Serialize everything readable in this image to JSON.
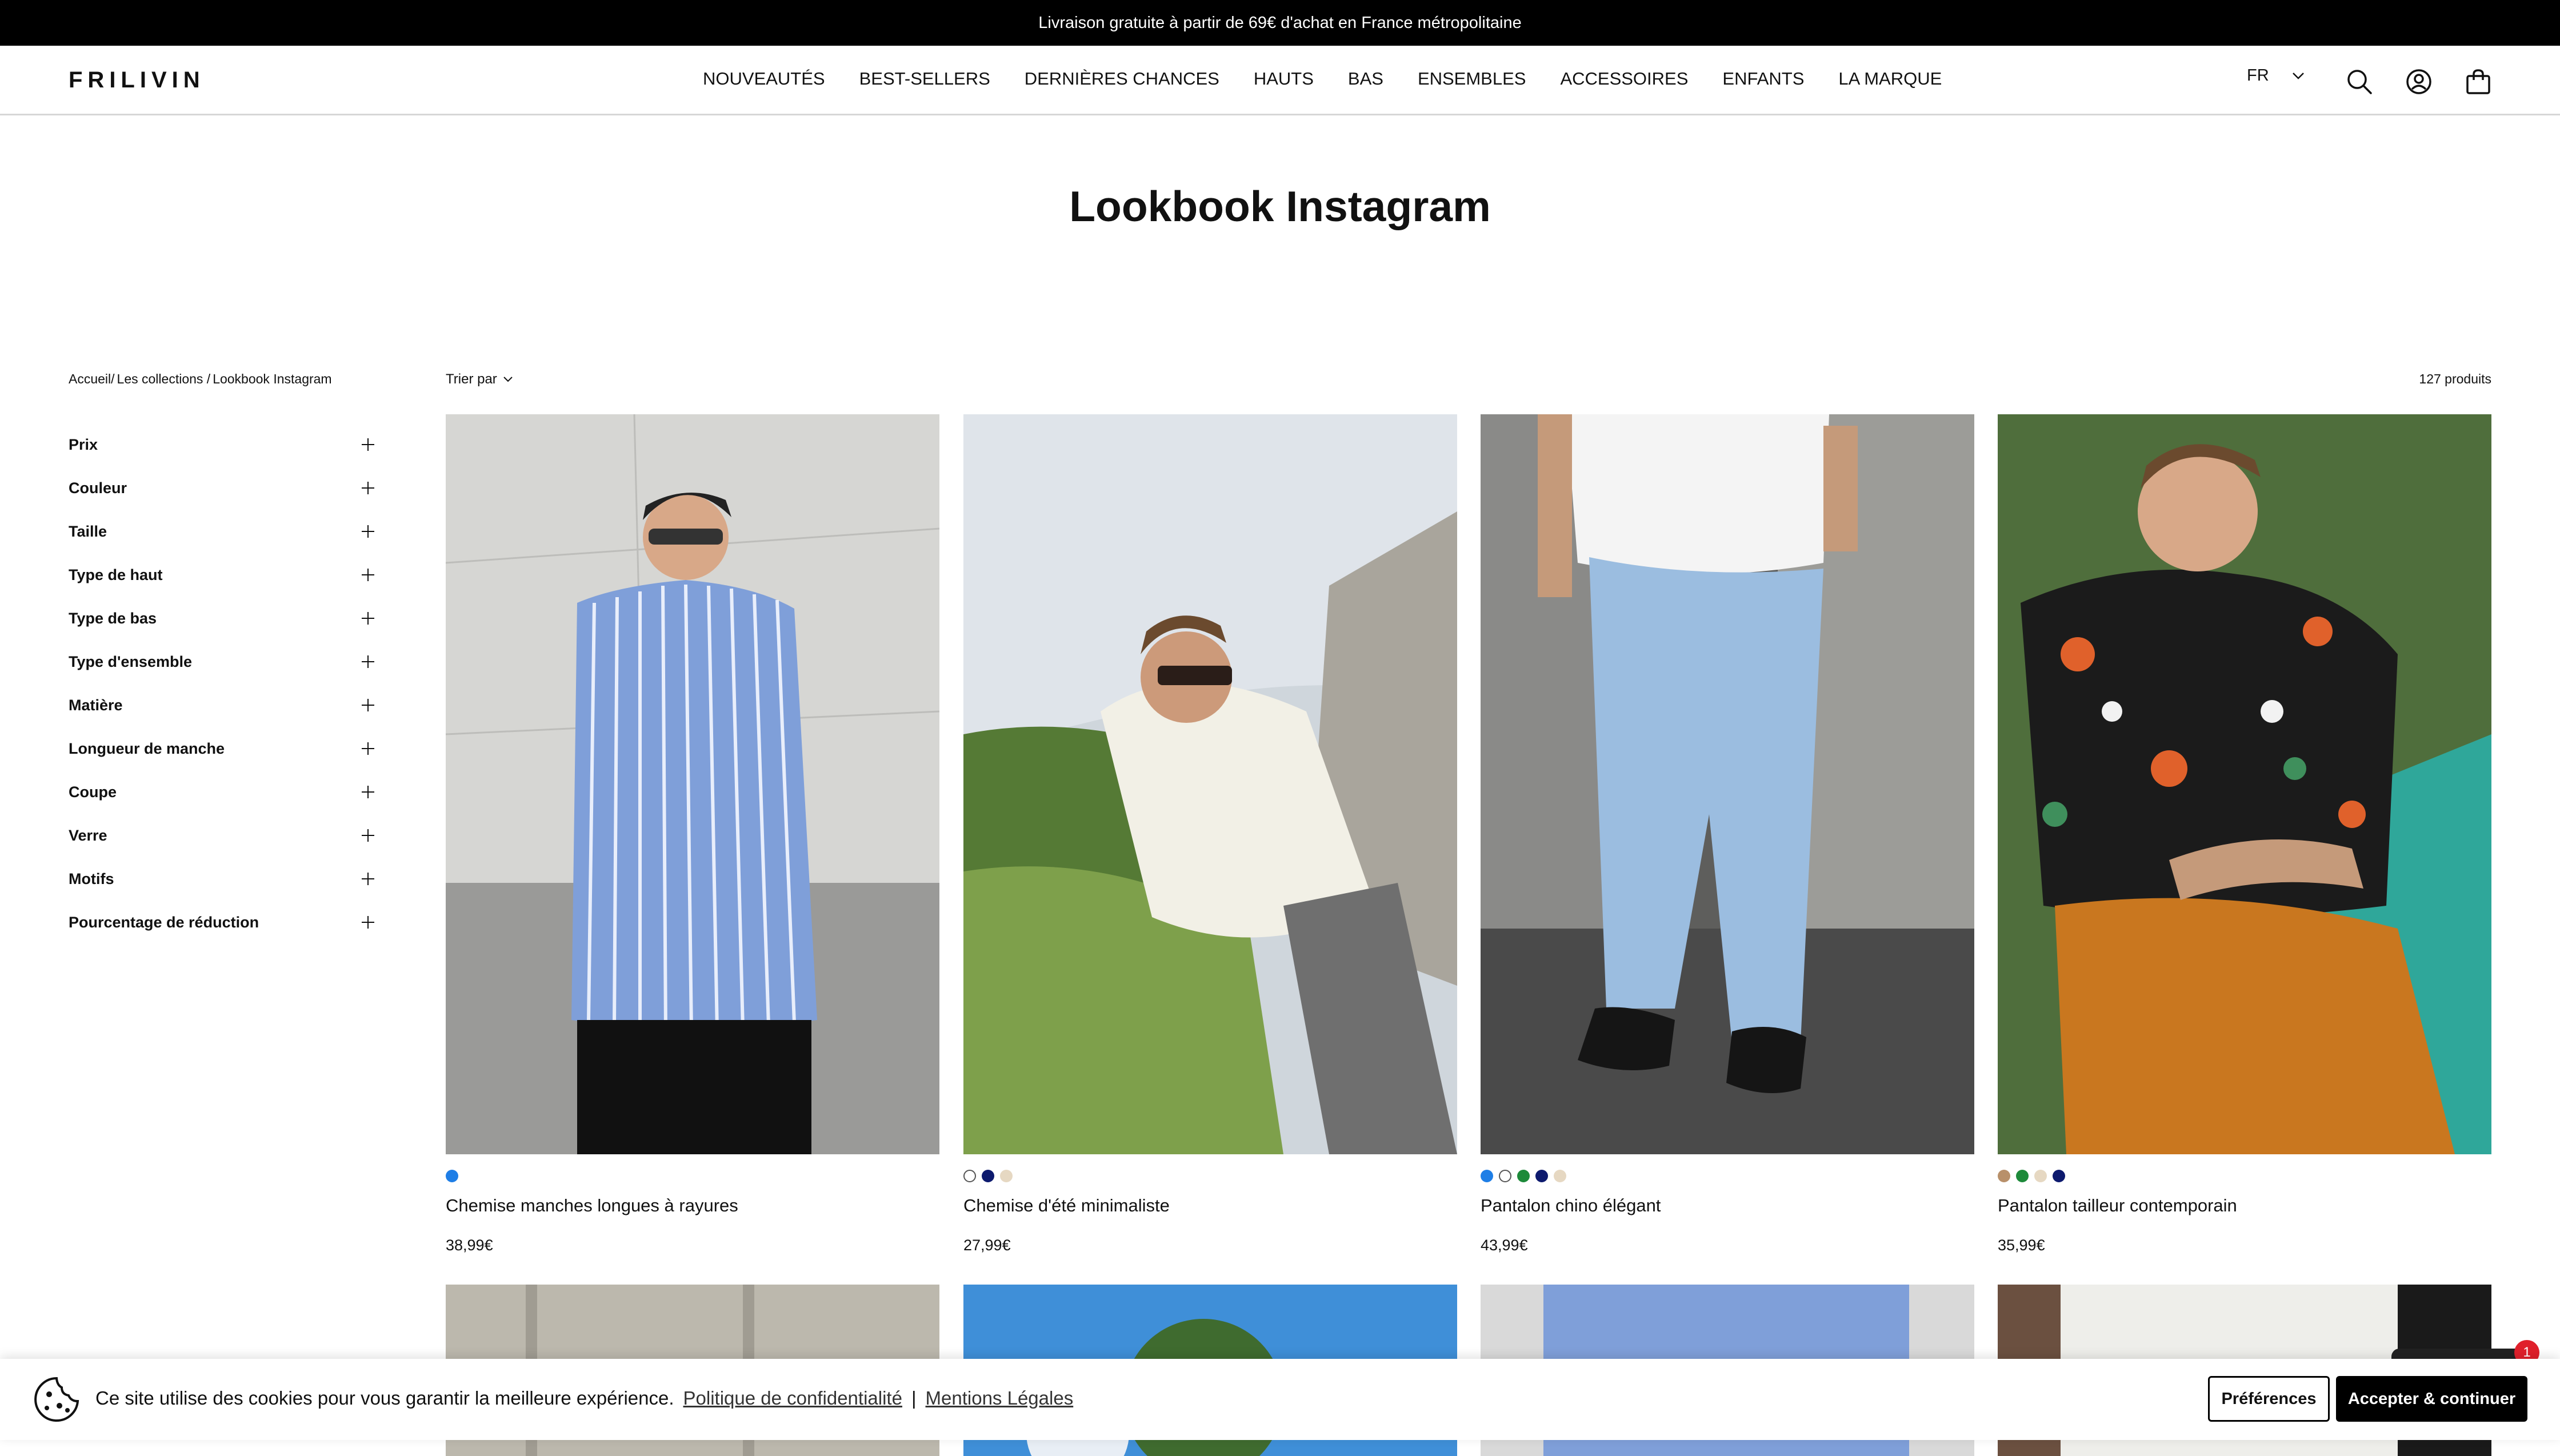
{
  "announcement": "Livraison gratuite à partir de 69€ d'achat en France métropolitaine",
  "header": {
    "logo": "FRILIVIN",
    "nav": [
      "NOUVEAUTÉS",
      "BEST-SELLERS",
      "DERNIÈRES CHANCES",
      "HAUTS",
      "BAS",
      "ENSEMBLES",
      "ACCESSOIRES",
      "ENFANTS",
      "LA MARQUE"
    ],
    "language": "FR",
    "icons": [
      "search-icon",
      "account-icon",
      "cart-icon"
    ]
  },
  "page": {
    "title": "Lookbook Instagram",
    "breadcrumb": [
      "Accueil/",
      "Les collections /",
      "Lookbook Instagram"
    ],
    "sort_label": "Trier par",
    "count": "127 produits"
  },
  "filters": [
    "Prix",
    "Couleur",
    "Taille",
    "Type de haut",
    "Type de bas",
    "Type d'ensemble",
    "Matière",
    "Longueur de manche",
    "Coupe",
    "Verre",
    "Motifs",
    "Pourcentage de réduction"
  ],
  "products": [
    {
      "name": "Chemise manches longues à rayures",
      "price": "38,99€",
      "swatches": [
        "#1e7ee6"
      ]
    },
    {
      "name": "Chemise d'été minimaliste",
      "price": "27,99€",
      "swatches": [
        "#ffffff",
        "#0d1a6e",
        "#e6d8c2"
      ]
    },
    {
      "name": "Pantalon chino élégant",
      "price": "43,99€",
      "swatches": [
        "#1e7ee6",
        "#ffffff",
        "#1d8a3a",
        "#0d1a6e",
        "#e6d8c2"
      ]
    },
    {
      "name": "Pantalon tailleur contemporain",
      "price": "35,99€",
      "swatches": [
        "#b8906a",
        "#1d8a3a",
        "#e6d8c2",
        "#0d1a6e"
      ]
    }
  ],
  "cookie": {
    "text": "Ce site utilise des cookies pour vous garantir la meilleure expérience.",
    "privacy_link": "Politique de confidentialité",
    "separator": "|",
    "legal_link": "Mentions Légales",
    "preferences_button": "Préférences",
    "accept_button": "Accepter & continuer"
  },
  "chat_badge": "1"
}
